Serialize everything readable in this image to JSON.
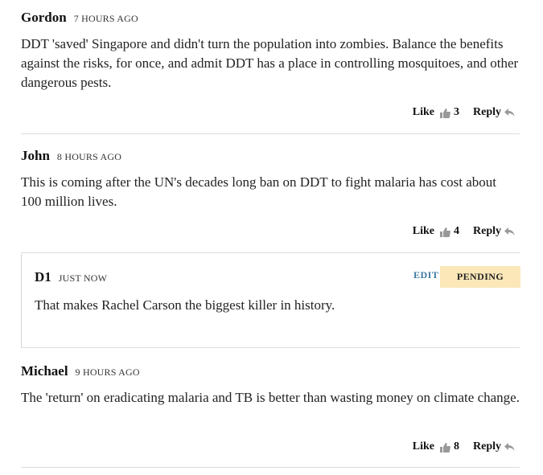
{
  "comments": [
    {
      "author": "Gordon",
      "time": "7 HOURS AGO",
      "body": "DDT 'saved' Singapore and didn't turn the population into zombies. Balance the benefits against the risks, for once, and admit DDT has a place in controlling mosquitoes, and other dangerous pests.",
      "like_label": "Like",
      "likes": "3",
      "reply_label": "Reply"
    },
    {
      "author": "John",
      "time": "8 HOURS AGO",
      "body": "This is coming after the UN's decades long ban on DDT to fight malaria has cost about 100 million lives.",
      "like_label": "Like",
      "likes": "4",
      "reply_label": "Reply"
    },
    {
      "author": "Michael",
      "time": "9 HOURS AGO",
      "body": "The 'return' on eradicating malaria and TB is better than wasting money on climate change.",
      "like_label": "Like",
      "likes": "8",
      "reply_label": "Reply"
    }
  ],
  "pending": {
    "author": "D1",
    "time": "JUST NOW",
    "body": "That makes Rachel Carson the biggest killer in history.",
    "edit_label": "EDIT",
    "status": "PENDING"
  },
  "colors": {
    "text": "#222222",
    "edit_link": "#3a7aa0",
    "pending_badge": "#fbe7b8",
    "divider": "#dddddd"
  },
  "icons": [
    "thumbs-up-icon",
    "reply-arrow-icon"
  ]
}
